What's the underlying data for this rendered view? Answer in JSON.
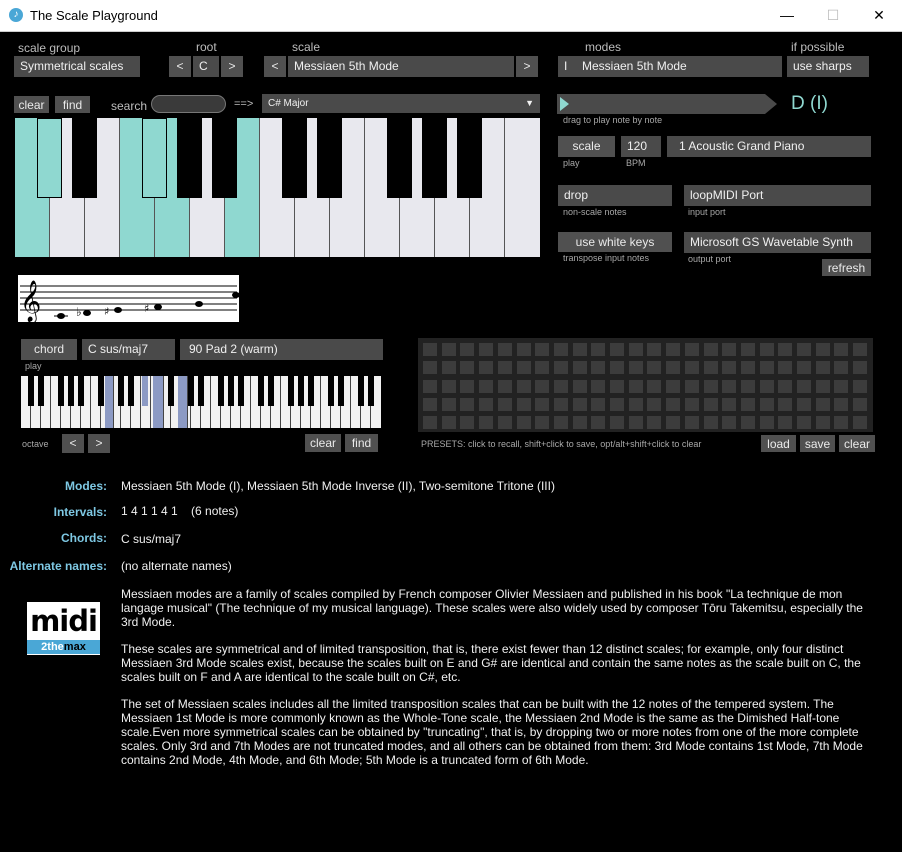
{
  "window": {
    "title": "The Scale Playground",
    "minimize": "—",
    "maximize": "☐",
    "close": "✕"
  },
  "top": {
    "scale_group_label": "scale group",
    "scale_group_value": "Symmetrical scales",
    "root_label": "root",
    "root_value": "C",
    "prev": "<",
    "next": ">",
    "scale_label": "scale",
    "scale_value": "Messiaen 5th Mode",
    "modes_label": "modes",
    "modes_numeral": "I",
    "modes_value": "Messiaen 5th Mode",
    "if_possible_label": "if possible",
    "if_possible_value": "use sharps"
  },
  "search": {
    "clear": "clear",
    "find": "find",
    "label": "search",
    "value": "",
    "arrow": "==>",
    "result": "C# Major"
  },
  "drag": {
    "label": "drag to play note by note",
    "note": "D (I)"
  },
  "play": {
    "scale_btn": "scale",
    "play_label": "play",
    "bpm_value": "120",
    "bpm_label": "BPM",
    "instrument": "1 Acoustic Grand Piano"
  },
  "nonscale": {
    "value": "drop",
    "label": "non-scale notes"
  },
  "input_port": {
    "value": "loopMIDI Port",
    "label": "input port"
  },
  "transpose": {
    "value": "use white keys",
    "label": "transpose input notes"
  },
  "output_port": {
    "value": "Microsoft GS Wavetable Synth",
    "label": "output port",
    "refresh": "refresh"
  },
  "chord": {
    "btn": "chord",
    "play_label": "play",
    "name": "C sus/maj7",
    "instrument": "90 Pad 2 (warm)",
    "octave_label": "octave",
    "clear": "clear",
    "find": "find"
  },
  "presets": {
    "hint": "PRESETS: click to recall, shift+click to save, opt/alt+shift+click to clear",
    "load": "load",
    "save": "save",
    "clear": "clear"
  },
  "info": {
    "modes_key": "Modes:",
    "modes_val": "Messiaen 5th Mode (I), Messiaen 5th Mode Inverse (II), Two-semitone Tritone (III)",
    "intervals_key": "Intervals:",
    "intervals_val": "1 4 1 1 4 1    (6 notes)",
    "chords_key": "Chords:",
    "chords_val": "C sus/maj7",
    "alt_key": "Alternate names:",
    "alt_val": "(no alternate names)"
  },
  "logo": {
    "word": "midi",
    "sub_a": "2the",
    "sub_b": "max"
  },
  "description": [
    "Messiaen modes are a family of scales compiled by French composer Olivier Messiaen and published in his book \"La technique de mon langage musical\" (The technique of my musical language). These scales were also widely used by composer Tōru Takemitsu, especially the 3rd Mode.",
    "These scales are symmetrical and of limited transposition, that is, there exist fewer than 12 distinct scales; for example, only four distinct Messiaen 3rd Mode scales exist, because the scales built on E and G# are identical and contain the same notes as the scale built on C, the scales built on F and A are identical to the scale built on C#, etc.",
    "The set of Messiaen scales includes all the limited transposition scales that can be built with the 12 notes of the tempered system. The Messiaen 1st Mode is more commonly known as the Whole-Tone scale, the Messiaen 2nd Mode is the same as the Dimished Half-tone scale.Even more symmetrical scales can be obtained by \"truncating\", that is, by dropping two or more notes from one of the more complete scales. Only 3rd and 7th Modes are not truncated modes, and all others can be obtained from them: 3rd Mode contains 1st Mode, 7th Mode contains 2nd Mode, 4th Mode, and 6th Mode; 5th Mode is a truncated form of 6th Mode."
  ],
  "colors": {
    "accent": "#8fd8d0",
    "chord_highlight": "#8c9ac4",
    "key_label": "#7ec8e3"
  }
}
